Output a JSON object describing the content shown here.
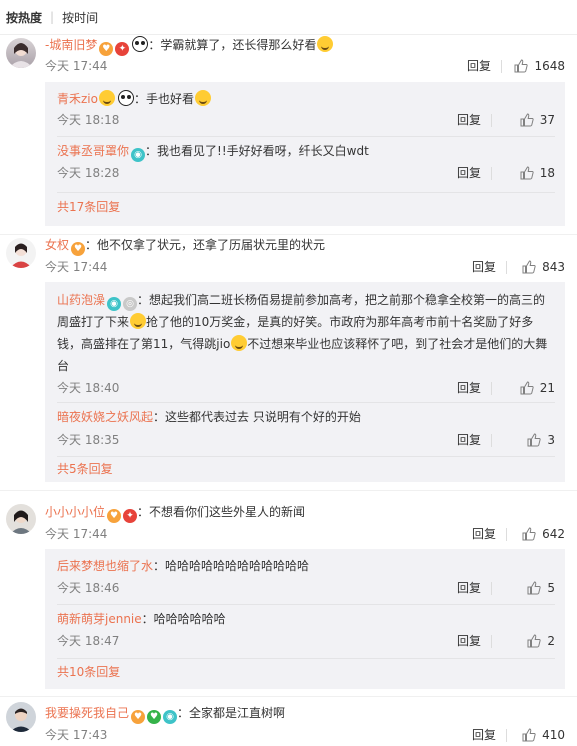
{
  "tabs": [
    "按热度",
    "按时间"
  ],
  "reply_label": "回复",
  "comments": [
    {
      "user": "-城南旧梦",
      "text": "：学霸就算了，还长得那么好看",
      "time": "今天 17:44",
      "likes": "1648",
      "replies": [
        {
          "user": "青禾zio",
          "text": "：手也好看",
          "time": "今天 18:18",
          "likes": "37"
        },
        {
          "user": "没事丞哥罩你",
          "text": "：我也看见了!!手好好看呀，纤长又白wdt",
          "time": "今天 18:28",
          "likes": "18"
        }
      ],
      "more": "共17条回复"
    },
    {
      "user": "女权",
      "text": "：他不仅拿了状元，还拿了历届状元里的状元",
      "time": "今天 17:44",
      "likes": "843",
      "replies": [
        {
          "user": "山药泡澡",
          "text_l1": "：想起我们高二班长杨佰易提前参加高考，把之前那个稳拿全校第一的高三的",
          "text_l2a": "周盛打了下来",
          "text_l2b": "抢了他的10万奖金，是真的好笑。市政府为那年高考市前十名奖励了好多",
          "text_l3a": "钱，高盛排在了第11，气得跳jio",
          "text_l3b": "不过想来毕业也应该释怀了吧，到了社会才是他们的大舞",
          "text_l4": "台",
          "time": "今天 18:40",
          "likes": "21"
        },
        {
          "user": "暗夜妖娆之妖风起",
          "text": "：这些都代表过去 只说明有个好的开始",
          "time": "今天 18:35",
          "likes": "3"
        }
      ],
      "more": "共5条回复"
    },
    {
      "user": "小小小小位",
      "text": "：不想看你们这些外星人的新闻",
      "time": "今天 17:44",
      "likes": "642",
      "replies": [
        {
          "user": "后来梦想也缩了水",
          "text": "：哈哈哈哈哈哈哈哈哈哈哈哈",
          "time": "今天 18:46",
          "likes": "5"
        },
        {
          "user": "萌新萌芽jennie",
          "text": "：哈哈哈哈哈哈",
          "time": "今天 18:47",
          "likes": "2"
        }
      ],
      "more": "共10条回复"
    },
    {
      "user": "我要操死我自己",
      "text": "：全家都是江直树啊",
      "time": "今天 17:43",
      "likes": "410",
      "replies": [],
      "more": ""
    }
  ]
}
